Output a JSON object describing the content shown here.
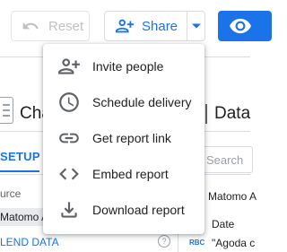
{
  "toolbar": {
    "reset_label": "Reset",
    "share_label": "Share"
  },
  "background": {
    "chart_title": "Cha",
    "data_title": "Data",
    "setup_tab": "SETUP",
    "search_placeholder": "Search",
    "source_label": "urce",
    "source_chip": "Matomo A",
    "blend_link": "LEND DATA",
    "help_glyph": "?",
    "right_source": "Matomo A",
    "date_label": "Date",
    "abc_badge": "RBC",
    "agoda_text": "\"Agoda c"
  },
  "menu": {
    "items": [
      {
        "label": "Invite people",
        "icon": "person-add-icon"
      },
      {
        "label": "Schedule delivery",
        "icon": "clock-icon"
      },
      {
        "label": "Get report link",
        "icon": "link-icon"
      },
      {
        "label": "Embed report",
        "icon": "code-icon"
      },
      {
        "label": "Download report",
        "icon": "download-icon"
      }
    ]
  },
  "colors": {
    "accent": "#1a73e8",
    "icon": "#5f6368",
    "disabled": "#bdc1c6",
    "text": "#202124"
  }
}
